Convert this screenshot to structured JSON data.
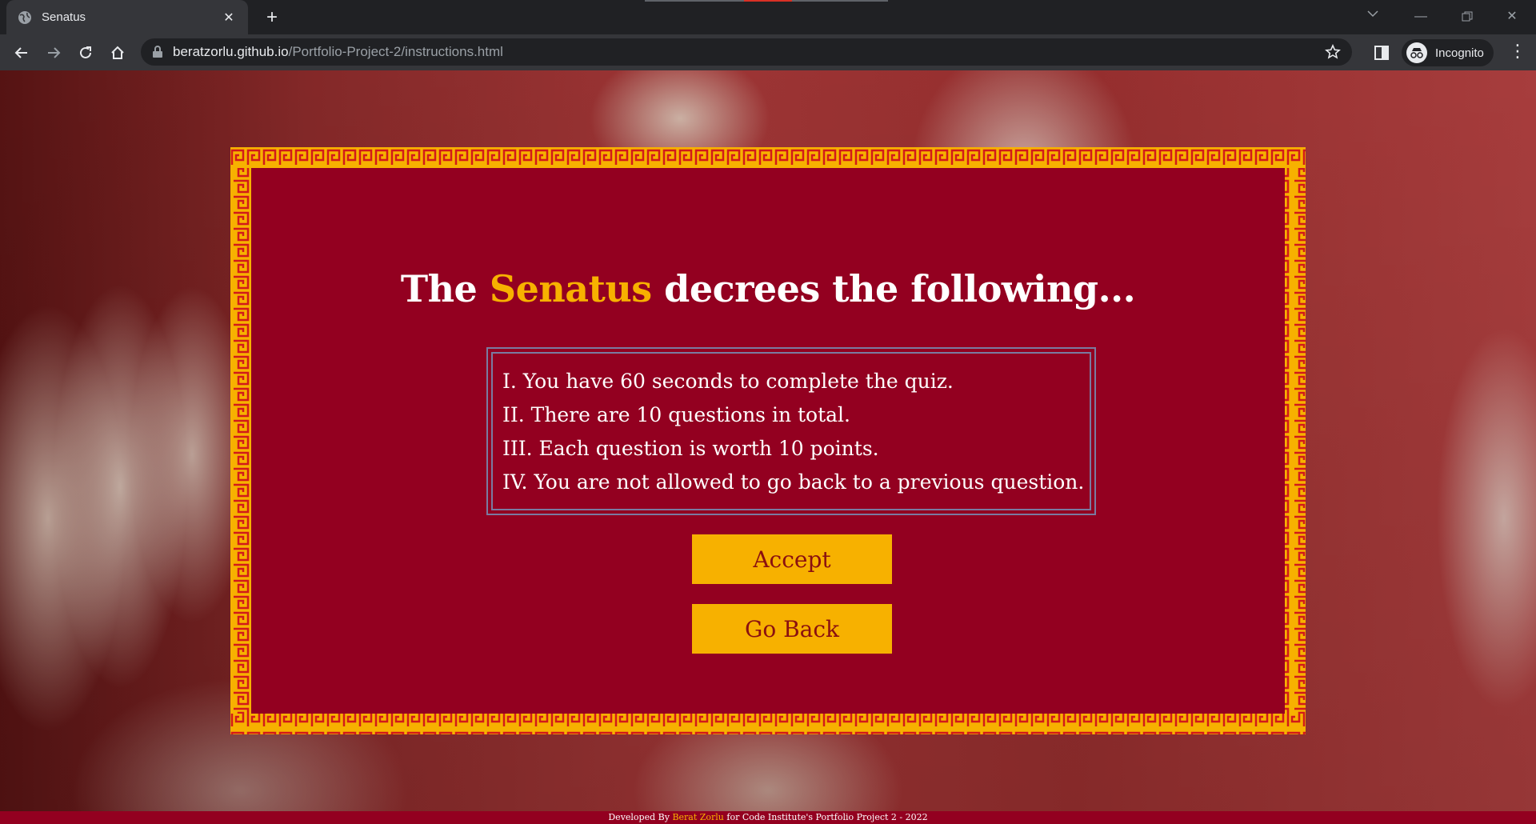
{
  "browser": {
    "tab_title": "Senatus",
    "url_host": "beratzorlu.github.io",
    "url_path": "/Portfolio-Project-2/instructions.html",
    "profile_label": "Incognito"
  },
  "page": {
    "heading_prefix": "The ",
    "heading_accent": "Senatus",
    "heading_suffix": " decrees the following...",
    "rules": [
      "I. You have 60 seconds to complete the quiz.",
      "II. There are 10 questions in total.",
      "III. Each question is worth 10 points.",
      "IV. You are not allowed to go back to a previous question."
    ],
    "accept_label": "Accept",
    "back_label": "Go Back",
    "footer_prefix": "Developed By ",
    "footer_name": "Berat Zorlu",
    "footer_suffix": " for Code Institute's Portfolio Project 2 - 2022"
  },
  "colors": {
    "card_bg": "#930020",
    "accent_gold": "#f7b100",
    "meander_red": "#d21a1a"
  }
}
